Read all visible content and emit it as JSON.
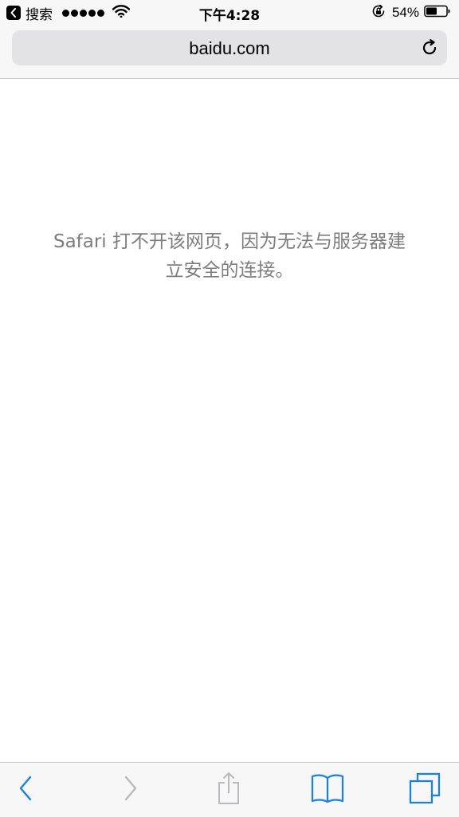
{
  "status_bar": {
    "back_app_label": "搜索",
    "signal_bars": 5,
    "time": "下午4:28",
    "battery_percent": "54%",
    "battery_level": 0.54,
    "icons": [
      "back-to-app-icon",
      "wifi-icon",
      "orientation-lock-icon",
      "battery-icon"
    ]
  },
  "address_bar": {
    "url": "baidu.com",
    "reload_icon": "reload-icon"
  },
  "content": {
    "error_message": "Safari 打不开该网页，因为无法与服务器建立安全的连接。"
  },
  "toolbar": {
    "icons": [
      "back-icon",
      "forward-icon",
      "share-icon",
      "bookmarks-icon",
      "tabs-icon"
    ],
    "back_enabled": true,
    "forward_enabled": false,
    "share_enabled": false
  },
  "colors": {
    "accent": "#157efb",
    "disabled": "#b9b9bd",
    "message_text": "#7d7d7d",
    "bar_background": "#f7f7f7",
    "url_field_background": "#e3e3e6"
  }
}
